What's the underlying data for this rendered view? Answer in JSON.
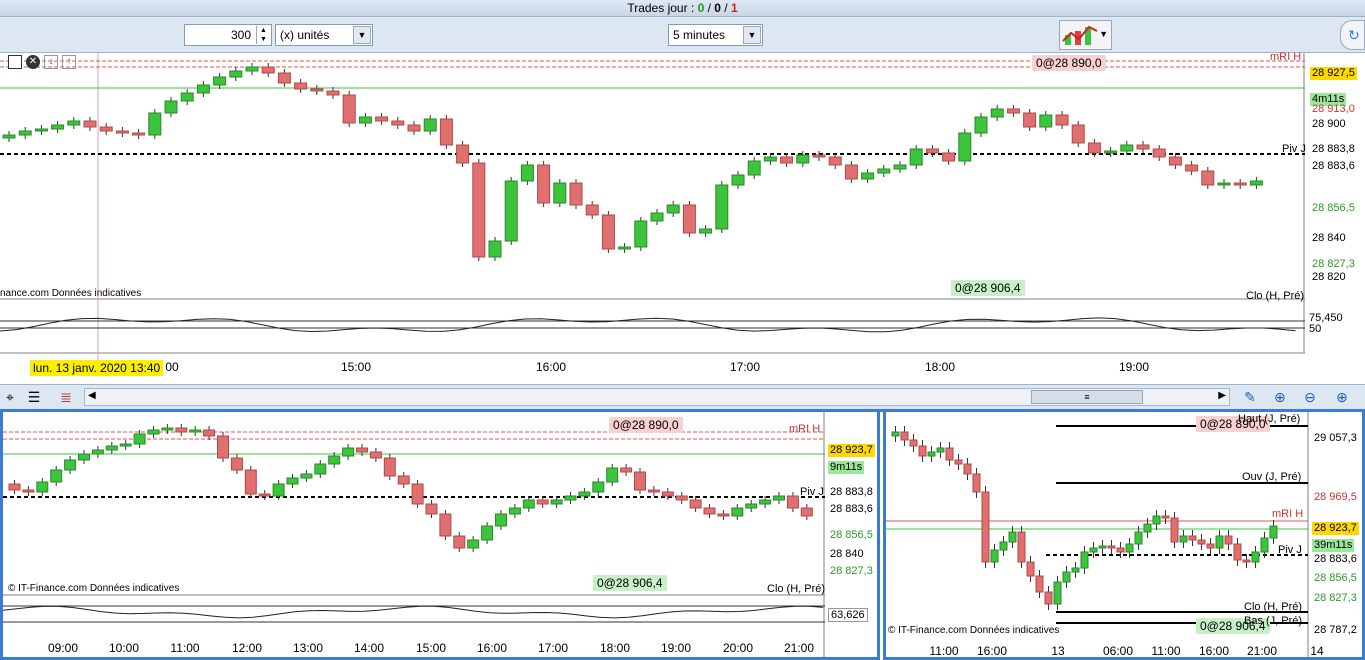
{
  "topbar": {
    "prefix": "Trades jour : ",
    "green": "0",
    "sep1": " / ",
    "black": "0",
    "sep2": " / ",
    "red": "1"
  },
  "toolbar": {
    "quantity": "300",
    "unit_select": "(x) unités",
    "period_select": "5 minutes"
  },
  "main": {
    "price_labels": [
      {
        "text": "mRI H",
        "color": "#d03030"
      },
      {
        "text": "28 927,5",
        "color": "#000",
        "bg": "#ffd800"
      },
      {
        "text": "4m11s",
        "color": "#000",
        "bg": "#9be89b"
      },
      {
        "text": "28 913,0",
        "color": "#d03030"
      },
      {
        "text": "28 900",
        "color": "#000"
      },
      {
        "text": "Piv J",
        "color": "#000"
      },
      {
        "text": "28 883,8",
        "color": "#000"
      },
      {
        "text": "28 883,6",
        "color": "#000"
      },
      {
        "text": "28 856,5",
        "color": "#2a9a2a"
      },
      {
        "text": "28 840",
        "color": "#000"
      },
      {
        "text": "28 827,3",
        "color": "#2a9a2a"
      },
      {
        "text": "28 820",
        "color": "#000"
      },
      {
        "text": "Clo (H, Pré)",
        "color": "#000"
      }
    ],
    "order_top": "0@28 890,0",
    "order_bottom": "0@28 906,4",
    "footer": "nance.com  Données indicatives",
    "osc_values": [
      "75,450",
      "50"
    ],
    "date_tag": "lun. 13 janv. 2020 13:40",
    "time_ticks": [
      "00",
      "15:00",
      "16:00",
      "17:00",
      "18:00",
      "19:00"
    ]
  },
  "bottom_left": {
    "labels": [
      {
        "text": "mRI H",
        "color": "#d03030"
      },
      {
        "text": "28 923,7",
        "color": "#000",
        "bg": "#ffd800"
      },
      {
        "text": "9m11s",
        "color": "#000",
        "bg": "#9be89b"
      },
      {
        "text": "Piv J",
        "color": "#000"
      },
      {
        "text": "28 883,8",
        "color": "#000"
      },
      {
        "text": "28 883,6",
        "color": "#000"
      },
      {
        "text": "28 856,5",
        "color": "#2a9a2a"
      },
      {
        "text": "28 840",
        "color": "#000"
      },
      {
        "text": "28 827,3",
        "color": "#2a9a2a"
      },
      {
        "text": "Clo (H, Pré)",
        "color": "#000"
      }
    ],
    "order_top": "0@28 890,0",
    "order_bottom": "0@28 906,4",
    "footer": "© IT-Finance.com  Données indicatives",
    "osc_value": "63,626",
    "time_ticks": [
      "09:00",
      "10:00",
      "11:00",
      "12:00",
      "13:00",
      "14:00",
      "15:00",
      "16:00",
      "17:00",
      "18:00",
      "19:00",
      "20:00",
      "21:00"
    ]
  },
  "bottom_right": {
    "labels": [
      {
        "text": "Haut (J, Pré)",
        "color": "#000"
      },
      {
        "text": "29 057,3",
        "color": "#000"
      },
      {
        "text": "Ouv (J, Pré)",
        "color": "#000"
      },
      {
        "text": "28 969,5",
        "color": "#d03030"
      },
      {
        "text": "mRI H",
        "color": "#d03030"
      },
      {
        "text": "28 923,7",
        "color": "#000",
        "bg": "#ffd800"
      },
      {
        "text": "39m11s",
        "color": "#000",
        "bg": "#9be89b"
      },
      {
        "text": "Piv J",
        "color": "#000"
      },
      {
        "text": "28 883,6",
        "color": "#000"
      },
      {
        "text": "28 856,5",
        "color": "#2a9a2a"
      },
      {
        "text": "28 827,3",
        "color": "#2a9a2a"
      },
      {
        "text": "Clo (H, Pré)",
        "color": "#000"
      },
      {
        "text": "Bas (J, Pré)",
        "color": "#000"
      },
      {
        "text": "28 787,2",
        "color": "#000"
      }
    ],
    "order_top": "0@28 890,0",
    "order_bottom": "0@28 906,4",
    "footer": "© IT-Finance.com  Données indicatives",
    "time_ticks": [
      "11:00",
      "16:00",
      "13",
      "06:00",
      "11:00",
      "16:00",
      "21:00",
      "14"
    ]
  },
  "colors": {
    "up": "#3cc43c",
    "down": "#e07070",
    "accent": "#3a7bd5"
  }
}
